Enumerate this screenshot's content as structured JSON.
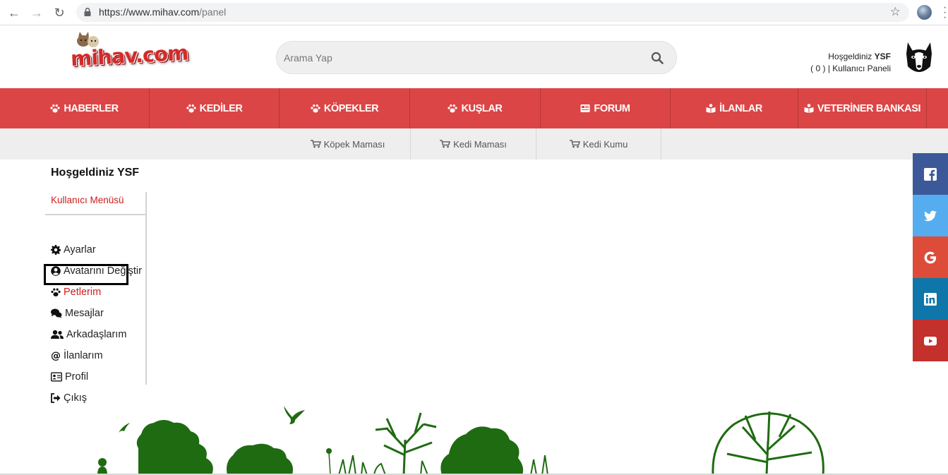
{
  "browser": {
    "url_host": "https://www.mihav.com",
    "url_path": "/panel"
  },
  "header": {
    "logo_text": "mihav.com",
    "search_placeholder": "Arama Yap",
    "welcome_prefix": "Hoşgeldiniz",
    "username": "YSF",
    "message_count": "( 0 )",
    "separator": "|",
    "panel_link": "Kullanıcı Paneli"
  },
  "main_nav": [
    {
      "label": "HABERLER",
      "icon": "paw-icon"
    },
    {
      "label": "KEDİLER",
      "icon": "paw-icon"
    },
    {
      "label": "KÖPEKLER",
      "icon": "paw-icon"
    },
    {
      "label": "KUŞLAR",
      "icon": "paw-icon"
    },
    {
      "label": "FORUM",
      "icon": "newspaper-icon"
    },
    {
      "label": "İLANLAR",
      "icon": "book-icon"
    },
    {
      "label": "VETERİNER BANKASI",
      "icon": "book-icon"
    }
  ],
  "sub_nav": [
    {
      "label": "Köpek Maması",
      "icon": "cart-icon"
    },
    {
      "label": "Kedi Maması",
      "icon": "cart-icon"
    },
    {
      "label": "Kedi Kumu",
      "icon": "cart-icon"
    }
  ],
  "panel": {
    "title": "Hoşgeldiniz YSF",
    "menu_heading": "Kullanıcı Menüsü",
    "menu_items": [
      {
        "label": "Ayarlar",
        "icon": "gear-icon"
      },
      {
        "label": "Avatarını Değiştir",
        "icon": "user-circle-icon"
      },
      {
        "label": "Petlerim",
        "icon": "paw-icon",
        "active": true
      },
      {
        "label": "Mesajlar",
        "icon": "comments-icon"
      },
      {
        "label": "Arkadaşlarım",
        "icon": "users-icon"
      },
      {
        "label": "İlanlarım",
        "icon": "at-icon"
      },
      {
        "label": "Profil",
        "icon": "id-card-icon"
      },
      {
        "label": "Çıkış",
        "icon": "sign-out-icon"
      }
    ]
  },
  "social": [
    {
      "name": "facebook",
      "color": "#3b5998"
    },
    {
      "name": "twitter",
      "color": "#55acee"
    },
    {
      "name": "google",
      "color": "#dd4b39"
    },
    {
      "name": "linkedin",
      "color": "#0e76a8"
    },
    {
      "name": "youtube",
      "color": "#c4302b"
    }
  ],
  "colors": {
    "nav_red": "#dc4545",
    "active_red": "#d31b1b",
    "footer_green": "#1f6b12"
  }
}
